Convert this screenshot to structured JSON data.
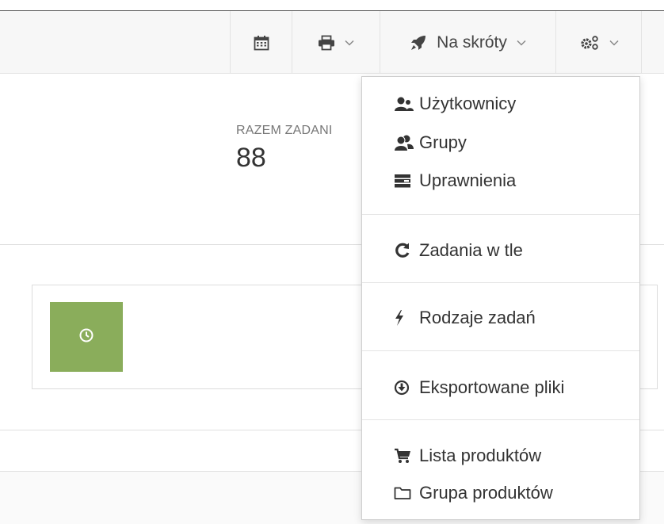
{
  "navbar": {
    "calendar_icon": "calendar-icon",
    "print_icon": "print-icon",
    "shortcuts_label": "Na skróty",
    "shortcuts_icon": "rocket-icon",
    "settings_icon": "cogs-icon"
  },
  "stat": {
    "label": "RAZEM ZADANI",
    "value": "88"
  },
  "card": {
    "icon": "clock-icon",
    "color": "#8aad5b"
  },
  "dropdown": {
    "groups": [
      {
        "items": [
          {
            "label": "Użytkownicy",
            "icon": "users-icon"
          },
          {
            "label": "Grupy",
            "icon": "group-icon"
          },
          {
            "label": "Uprawnienia",
            "icon": "permissions-icon"
          }
        ]
      },
      {
        "items": [
          {
            "label": "Zadania w tle",
            "icon": "refresh-icon"
          }
        ]
      },
      {
        "items": [
          {
            "label": "Rodzaje zadań",
            "icon": "bolt-icon"
          }
        ]
      },
      {
        "items": [
          {
            "label": "Eksportowane pliki",
            "icon": "download-circle-icon"
          }
        ]
      },
      {
        "items": [
          {
            "label": "Lista produktów",
            "icon": "cart-icon"
          },
          {
            "label": "Grupa produktów",
            "icon": "folder-icon"
          }
        ]
      }
    ]
  }
}
